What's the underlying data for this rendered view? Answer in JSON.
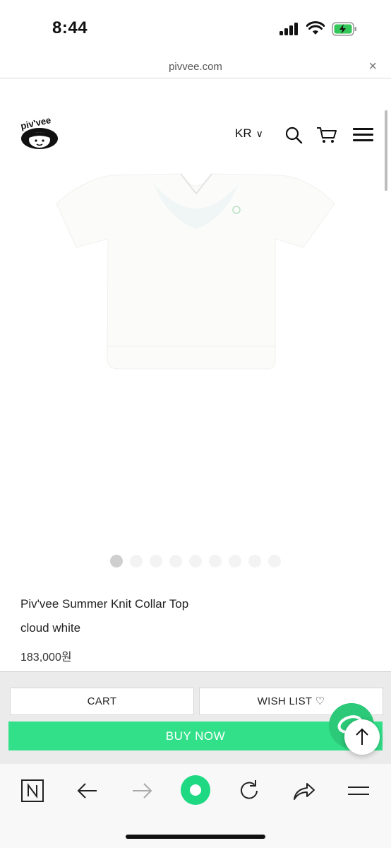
{
  "status_bar": {
    "time": "8:44",
    "icons": [
      "cellular-signal-icon",
      "wifi-icon",
      "battery-charging-icon"
    ]
  },
  "browser": {
    "url": "pivvee.com",
    "close_icon": "close-icon"
  },
  "header": {
    "logo_text": "Piv'vee",
    "language": "KR",
    "language_caret": "∨",
    "icons": [
      "search-icon",
      "cart-icon",
      "hamburger-menu-icon"
    ]
  },
  "product": {
    "image_description_icon": "product-photo",
    "name": "Piv'vee Summer Knit Collar Top",
    "variant": "cloud white",
    "price": "183,000원",
    "carousel": {
      "total": 9,
      "active_index": 0
    }
  },
  "purchase_bar": {
    "cart_label": "CART",
    "wishlist_label": "WISH LIST ♡",
    "buy_label": "BUY NOW"
  },
  "toolbar": {
    "icons": [
      "naver-home-icon",
      "back-arrow-icon",
      "forward-arrow-icon",
      "green-dot-icon",
      "reload-icon",
      "share-icon",
      "menu-icon"
    ]
  },
  "colors": {
    "accent_green": "#33e08a",
    "fab_green": "#2cc978",
    "battery_green": "#35c759"
  }
}
